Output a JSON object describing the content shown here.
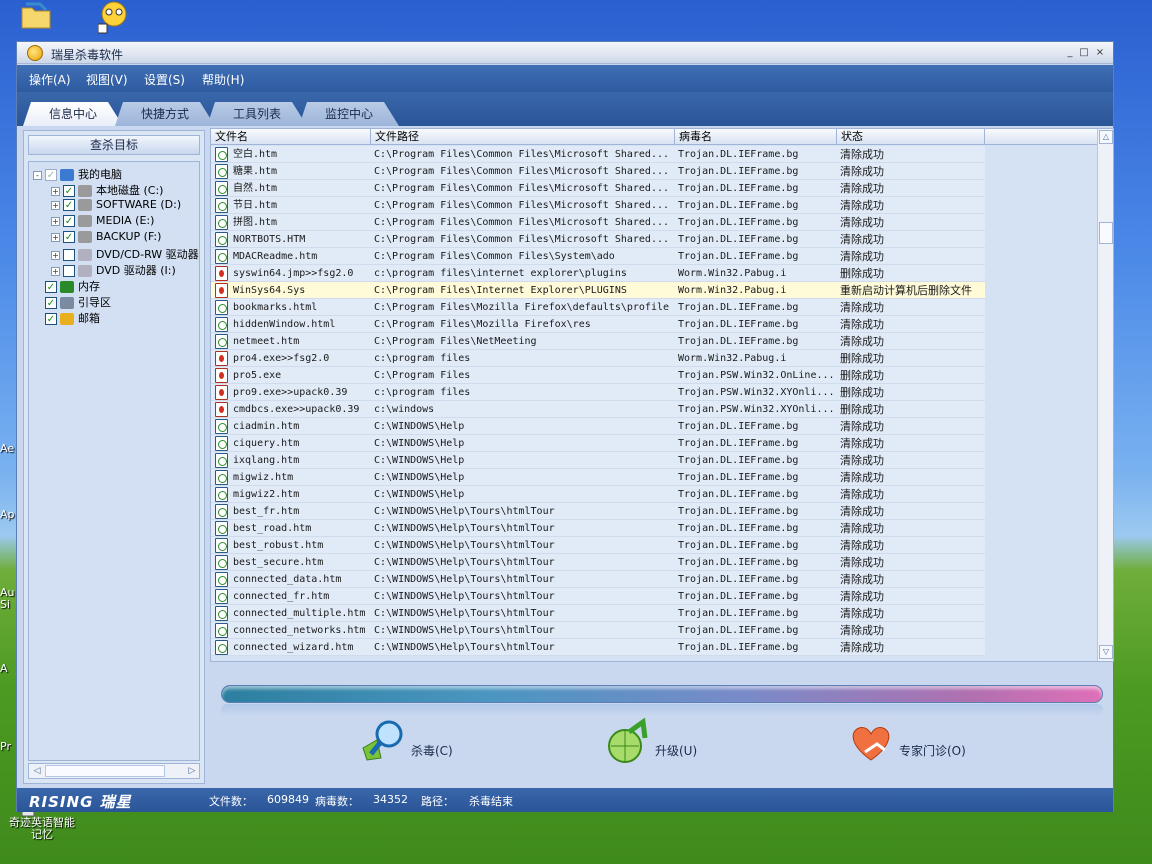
{
  "desktop": {
    "bottom_label": "奇迹英语智能\n记忆",
    "left_edge": [
      "Ae",
      "Ap",
      "Au",
      "Si",
      "A",
      "Pr"
    ]
  },
  "window": {
    "title": "瑞星杀毒软件",
    "controls": [
      "_",
      "□",
      "×"
    ]
  },
  "menu": [
    "操作(A)",
    "视图(V)",
    "设置(S)",
    "帮助(H)"
  ],
  "tabs": [
    {
      "label": "信息中心",
      "active": true
    },
    {
      "label": "快捷方式",
      "active": false
    },
    {
      "label": "工具列表",
      "active": false
    },
    {
      "label": "监控中心",
      "active": false
    }
  ],
  "left_panel": {
    "header": "查杀目标",
    "tree": [
      {
        "label": "我的电脑",
        "level": 0,
        "expand": "-",
        "checked": "partial",
        "icon": "computer-icon"
      },
      {
        "label": "本地磁盘 (C:)",
        "level": 1,
        "expand": "+",
        "checked": true,
        "icon": "disk-icon"
      },
      {
        "label": "SOFTWARE (D:)",
        "level": 1,
        "expand": "+",
        "checked": true,
        "icon": "disk-icon"
      },
      {
        "label": "MEDIA (E:)",
        "level": 1,
        "expand": "+",
        "checked": true,
        "icon": "disk-icon"
      },
      {
        "label": "BACKUP (F:)",
        "level": 1,
        "expand": "+",
        "checked": true,
        "icon": "disk-icon"
      },
      {
        "label": "DVD/CD-RW 驱动器",
        "level": 1,
        "expand": "+",
        "checked": false,
        "icon": "cdrom-icon"
      },
      {
        "label": "DVD 驱动器 (I:)",
        "level": 1,
        "expand": "+",
        "checked": false,
        "icon": "cdrom-icon"
      },
      {
        "label": "内存",
        "level": 0,
        "expand": "",
        "checked": true,
        "icon": "memory-icon"
      },
      {
        "label": "引导区",
        "level": 0,
        "expand": "",
        "checked": true,
        "icon": "bootsector-icon"
      },
      {
        "label": "邮箱",
        "level": 0,
        "expand": "",
        "checked": true,
        "icon": "mail-icon"
      }
    ]
  },
  "list": {
    "columns": [
      "文件名",
      "文件路径",
      "病毒名",
      "状态"
    ],
    "rows": [
      {
        "name": "空白.htm",
        "path": "C:\\Program Files\\Common Files\\Microsoft Shared...",
        "virus": "Trojan.DL.IEFrame.bg",
        "status": "清除成功",
        "icon": "html"
      },
      {
        "name": "糖果.htm",
        "path": "C:\\Program Files\\Common Files\\Microsoft Shared...",
        "virus": "Trojan.DL.IEFrame.bg",
        "status": "清除成功",
        "icon": "html"
      },
      {
        "name": "自然.htm",
        "path": "C:\\Program Files\\Common Files\\Microsoft Shared...",
        "virus": "Trojan.DL.IEFrame.bg",
        "status": "清除成功",
        "icon": "html"
      },
      {
        "name": "节日.htm",
        "path": "C:\\Program Files\\Common Files\\Microsoft Shared...",
        "virus": "Trojan.DL.IEFrame.bg",
        "status": "清除成功",
        "icon": "html"
      },
      {
        "name": "拼图.htm",
        "path": "C:\\Program Files\\Common Files\\Microsoft Shared...",
        "virus": "Trojan.DL.IEFrame.bg",
        "status": "清除成功",
        "icon": "html"
      },
      {
        "name": "NORTBOTS.HTM",
        "path": "C:\\Program Files\\Common Files\\Microsoft Shared...",
        "virus": "Trojan.DL.IEFrame.bg",
        "status": "清除成功",
        "icon": "html"
      },
      {
        "name": "MDACReadme.htm",
        "path": "C:\\Program Files\\Common Files\\System\\ado",
        "virus": "Trojan.DL.IEFrame.bg",
        "status": "清除成功",
        "icon": "html"
      },
      {
        "name": "syswin64.jmp>>fsg2.0",
        "path": "c:\\program files\\internet explorer\\plugins",
        "virus": "Worm.Win32.Pabug.i",
        "status": "删除成功",
        "icon": "bug"
      },
      {
        "name": "WinSys64.Sys",
        "path": "C:\\Program Files\\Internet Explorer\\PLUGINS",
        "virus": "Worm.Win32.Pabug.i",
        "status": "重新启动计算机后删除文件",
        "icon": "bug",
        "highlight": true
      },
      {
        "name": "bookmarks.html",
        "path": "C:\\Program Files\\Mozilla Firefox\\defaults\\profile",
        "virus": "Trojan.DL.IEFrame.bg",
        "status": "清除成功",
        "icon": "html"
      },
      {
        "name": "hiddenWindow.html",
        "path": "C:\\Program Files\\Mozilla Firefox\\res",
        "virus": "Trojan.DL.IEFrame.bg",
        "status": "清除成功",
        "icon": "html"
      },
      {
        "name": "netmeet.htm",
        "path": "C:\\Program Files\\NetMeeting",
        "virus": "Trojan.DL.IEFrame.bg",
        "status": "清除成功",
        "icon": "html"
      },
      {
        "name": "pro4.exe>>fsg2.0",
        "path": "c:\\program files",
        "virus": "Worm.Win32.Pabug.i",
        "status": "删除成功",
        "icon": "bug"
      },
      {
        "name": "pro5.exe",
        "path": "C:\\Program Files",
        "virus": "Trojan.PSW.Win32.OnLine...",
        "status": "删除成功",
        "icon": "bug"
      },
      {
        "name": "pro9.exe>>upack0.39",
        "path": "c:\\program files",
        "virus": "Trojan.PSW.Win32.XYOnli...",
        "status": "删除成功",
        "icon": "bug"
      },
      {
        "name": "cmdbcs.exe>>upack0.39",
        "path": "c:\\windows",
        "virus": "Trojan.PSW.Win32.XYOnli...",
        "status": "删除成功",
        "icon": "bug"
      },
      {
        "name": "ciadmin.htm",
        "path": "C:\\WINDOWS\\Help",
        "virus": "Trojan.DL.IEFrame.bg",
        "status": "清除成功",
        "icon": "html"
      },
      {
        "name": "ciquery.htm",
        "path": "C:\\WINDOWS\\Help",
        "virus": "Trojan.DL.IEFrame.bg",
        "status": "清除成功",
        "icon": "html"
      },
      {
        "name": "ixqlang.htm",
        "path": "C:\\WINDOWS\\Help",
        "virus": "Trojan.DL.IEFrame.bg",
        "status": "清除成功",
        "icon": "html"
      },
      {
        "name": "migwiz.htm",
        "path": "C:\\WINDOWS\\Help",
        "virus": "Trojan.DL.IEFrame.bg",
        "status": "清除成功",
        "icon": "html"
      },
      {
        "name": "migwiz2.htm",
        "path": "C:\\WINDOWS\\Help",
        "virus": "Trojan.DL.IEFrame.bg",
        "status": "清除成功",
        "icon": "html"
      },
      {
        "name": "best_fr.htm",
        "path": "C:\\WINDOWS\\Help\\Tours\\htmlTour",
        "virus": "Trojan.DL.IEFrame.bg",
        "status": "清除成功",
        "icon": "html"
      },
      {
        "name": "best_road.htm",
        "path": "C:\\WINDOWS\\Help\\Tours\\htmlTour",
        "virus": "Trojan.DL.IEFrame.bg",
        "status": "清除成功",
        "icon": "html"
      },
      {
        "name": "best_robust.htm",
        "path": "C:\\WINDOWS\\Help\\Tours\\htmlTour",
        "virus": "Trojan.DL.IEFrame.bg",
        "status": "清除成功",
        "icon": "html"
      },
      {
        "name": "best_secure.htm",
        "path": "C:\\WINDOWS\\Help\\Tours\\htmlTour",
        "virus": "Trojan.DL.IEFrame.bg",
        "status": "清除成功",
        "icon": "html"
      },
      {
        "name": "connected_data.htm",
        "path": "C:\\WINDOWS\\Help\\Tours\\htmlTour",
        "virus": "Trojan.DL.IEFrame.bg",
        "status": "清除成功",
        "icon": "html"
      },
      {
        "name": "connected_fr.htm",
        "path": "C:\\WINDOWS\\Help\\Tours\\htmlTour",
        "virus": "Trojan.DL.IEFrame.bg",
        "status": "清除成功",
        "icon": "html"
      },
      {
        "name": "connected_multiple.htm",
        "path": "C:\\WINDOWS\\Help\\Tours\\htmlTour",
        "virus": "Trojan.DL.IEFrame.bg",
        "status": "清除成功",
        "icon": "html"
      },
      {
        "name": "connected_networks.htm",
        "path": "C:\\WINDOWS\\Help\\Tours\\htmlTour",
        "virus": "Trojan.DL.IEFrame.bg",
        "status": "清除成功",
        "icon": "html"
      },
      {
        "name": "connected_wizard.htm",
        "path": "C:\\WINDOWS\\Help\\Tours\\htmlTour",
        "virus": "Trojan.DL.IEFrame.bg",
        "status": "清除成功",
        "icon": "html"
      }
    ]
  },
  "actions": [
    {
      "label": "杀毒(C)",
      "icon": "scan-magnifier-icon"
    },
    {
      "label": "升级(U)",
      "icon": "upgrade-globe-icon"
    },
    {
      "label": "专家门诊(O)",
      "icon": "expert-heart-icon"
    }
  ],
  "status": {
    "brand": "RISING 瑞星",
    "files_label": "文件数：",
    "files_value": "609849",
    "virus_label": "病毒数：",
    "virus_value": "34352",
    "path_label": "路径：",
    "path_value": "杀毒结束"
  },
  "colors": {
    "menu_bg": "#2e5aa0",
    "list_bg": "#e1ebf8",
    "highlight_row": "#fffbd9"
  }
}
